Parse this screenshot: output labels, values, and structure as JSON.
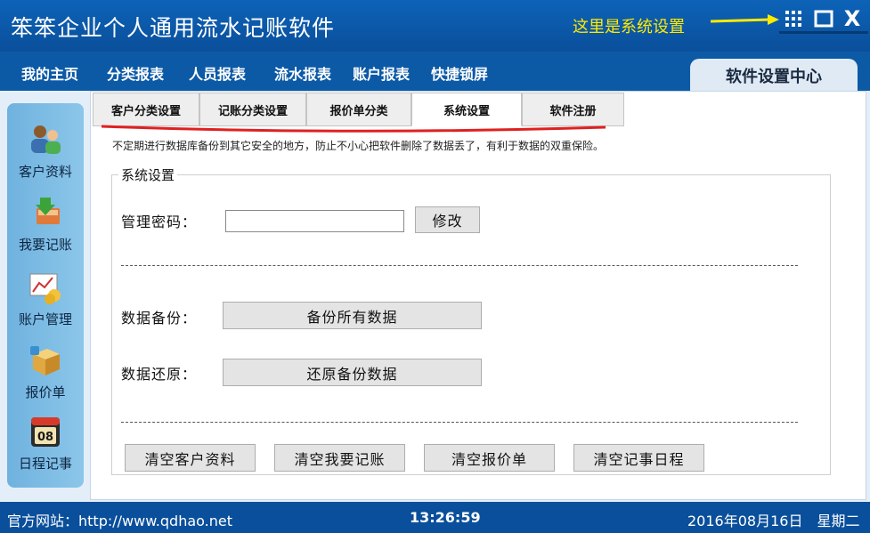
{
  "window": {
    "title": "笨笨企业个人通用流水记账软件",
    "annotation": "这里是系统设置",
    "close_glyph": "X"
  },
  "menu": {
    "items": [
      "我的主页",
      "分类报表",
      "人员报表",
      "流水报表",
      "账户报表",
      "快捷锁屏"
    ],
    "settings_center": "软件设置中心"
  },
  "sidebar": {
    "items": [
      {
        "label": "客户资料",
        "icon": "customer-icon"
      },
      {
        "label": "我要记账",
        "icon": "bookkeeping-icon"
      },
      {
        "label": "账户管理",
        "icon": "account-chart-icon"
      },
      {
        "label": "报价单",
        "icon": "package-icon"
      },
      {
        "label": "日程记事",
        "icon": "calendar-icon"
      }
    ],
    "calendar_day": "08"
  },
  "tabs": {
    "items": [
      "客户分类设置",
      "记账分类设置",
      "报价单分类",
      "系统设置",
      "软件注册"
    ],
    "active": "系统设置"
  },
  "system_settings": {
    "note": "不定期进行数据库备份到其它安全的地方，防止不小心把软件删除了数据丢了，有利于数据的双重保险。",
    "legend": "系统设置",
    "password_label": "管理密码：",
    "password_value": "",
    "modify_button": "修改",
    "backup_label": "数据备份：",
    "backup_button": "备份所有数据",
    "restore_label": "数据还原：",
    "restore_button": "还原备份数据",
    "clear_buttons": [
      "清空客户资料",
      "清空我要记账",
      "清空报价单",
      "清空记事日程"
    ]
  },
  "status": {
    "website": "官方网站：http://www.qdhao.net",
    "time": "13:26:59",
    "date": "2016年08月16日　星期二"
  },
  "colors": {
    "title_bar": "#0d63b8",
    "annotation": "#ffea00",
    "underline_marker": "#e02020",
    "sidebar": "#7fbde6"
  }
}
